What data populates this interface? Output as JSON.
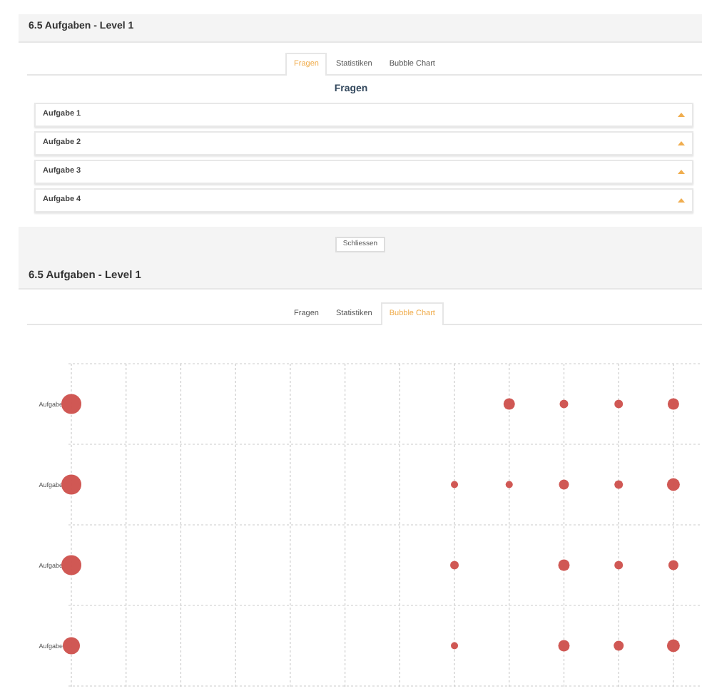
{
  "panel_1": {
    "title": "6.5 Aufgaben - Level 1",
    "tabs": [
      {
        "label": "Fragen",
        "selected": true
      },
      {
        "label": "Statistiken",
        "selected": false
      },
      {
        "label": "Bubble Chart",
        "selected": false
      }
    ],
    "heading": "Fragen",
    "accordion": [
      {
        "label": "Aufgabe 1",
        "expanded": false
      },
      {
        "label": "Aufgabe 2",
        "expanded": false
      },
      {
        "label": "Aufgabe 3",
        "expanded": false
      },
      {
        "label": "Aufgabe 4",
        "expanded": false
      }
    ],
    "footer_button": "Schliessen"
  },
  "panel_2": {
    "title": "6.5 Aufgaben - Level 1",
    "tabs": [
      {
        "label": "Fragen",
        "selected": false
      },
      {
        "label": "Statistiken",
        "selected": false
      },
      {
        "label": "Bubble Chart",
        "selected": true
      }
    ],
    "chart_row_labels": [
      "Aufgabe",
      "Aufgabe",
      "Aufgabe",
      "Aufgabe"
    ]
  }
}
